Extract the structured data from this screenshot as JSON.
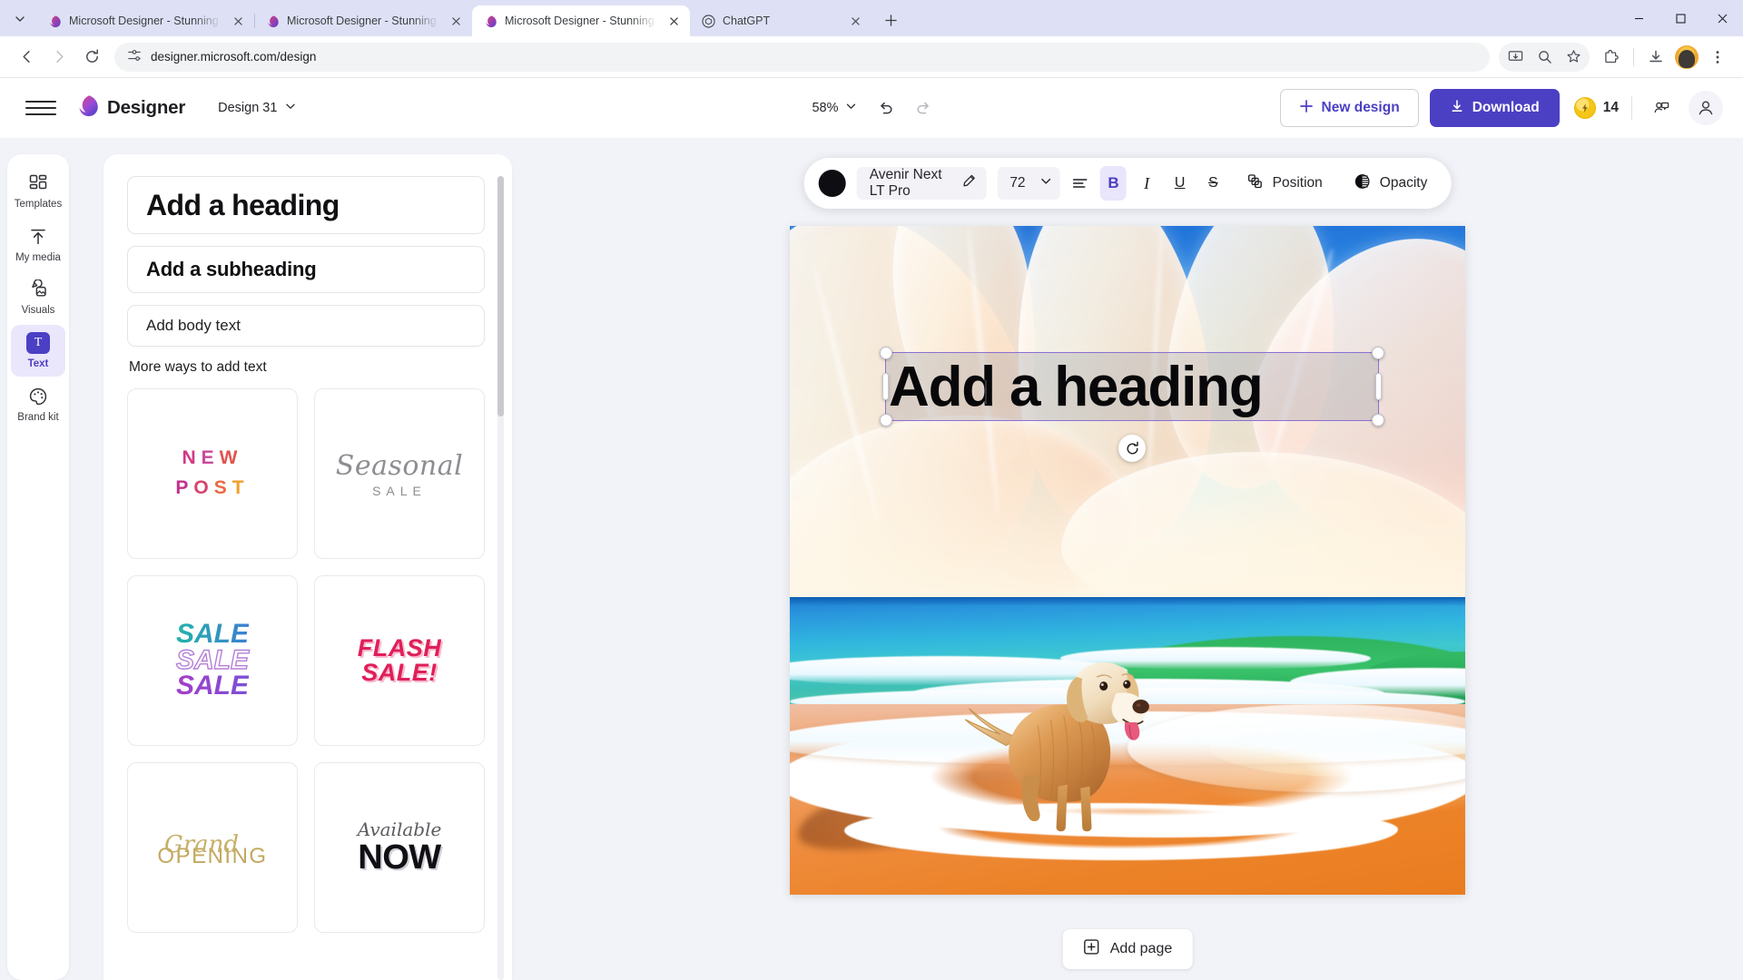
{
  "browser": {
    "tabs": [
      {
        "title": "Microsoft Designer - Stunning d",
        "favicon": "designer-icon",
        "active": false
      },
      {
        "title": "Microsoft Designer - Stunning d",
        "favicon": "designer-icon",
        "active": false
      },
      {
        "title": "Microsoft Designer - Stunning d",
        "favicon": "designer-icon",
        "active": true
      },
      {
        "title": "ChatGPT",
        "favicon": "chatgpt-icon",
        "active": false
      }
    ],
    "new_tab_label": "+",
    "url": "designer.microsoft.com/design",
    "window_controls": {
      "minimize": "–",
      "maximize": "□",
      "close": "✕"
    }
  },
  "header": {
    "brand": "Designer",
    "document_name": "Design 31",
    "zoom_level": "58%",
    "new_design_label": "New design",
    "download_label": "Download",
    "credits_count": "14"
  },
  "sidebar": {
    "items": [
      {
        "label": "Templates",
        "icon": "templates-icon",
        "active": false
      },
      {
        "label": "My media",
        "icon": "upload-arrow-icon",
        "active": false
      },
      {
        "label": "Visuals",
        "icon": "visuals-icon",
        "active": false
      },
      {
        "label": "Text",
        "icon": "text-icon",
        "active": true
      },
      {
        "label": "Brand kit",
        "icon": "palette-icon",
        "active": false
      }
    ]
  },
  "panel": {
    "presets": [
      {
        "label": "Add a heading",
        "style": "heading"
      },
      {
        "label": "Add a subheading",
        "style": "subheading"
      },
      {
        "label": "Add body text",
        "style": "body"
      }
    ],
    "subtitle": "More ways to add text",
    "cards": [
      {
        "name": "new-post",
        "lines": [
          "NEW",
          "POST"
        ]
      },
      {
        "name": "seasonal-sale",
        "script": "Seasonal",
        "caps": "SALE"
      },
      {
        "name": "sale-sale-sale",
        "lines": [
          "SALE",
          "SALE",
          "SALE"
        ]
      },
      {
        "name": "flash-sale",
        "lines": [
          "FLASH",
          "SALE!"
        ]
      },
      {
        "name": "grand-opening",
        "script": "Grand",
        "caps": "OPENING"
      },
      {
        "name": "available-now",
        "script": "Available",
        "caps": "NOW"
      }
    ]
  },
  "toolbar": {
    "color_swatch": "#0e0e12",
    "font_name": "Avenir Next LT Pro",
    "font_size": "72",
    "bold_label": "B",
    "italic_label": "I",
    "underline_label": "U",
    "strikethrough_label": "S",
    "position_label": "Position",
    "opacity_label": "Opacity"
  },
  "canvas": {
    "heading_text": "Add a heading",
    "selection_border_color": "#8b6fd4",
    "add_page_label": "Add page",
    "artwork_description": "Golden retriever on orange sand beach with turquoise waves and feathery clouds"
  }
}
